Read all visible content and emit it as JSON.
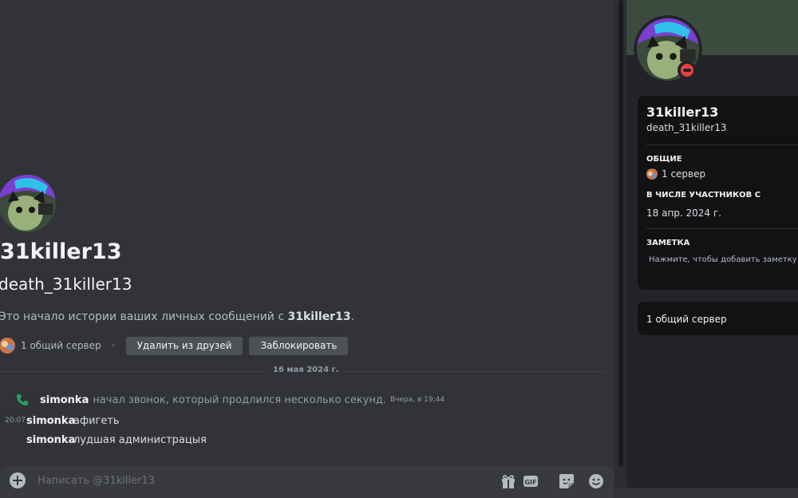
{
  "intro": {
    "display_name": "31killer13",
    "username": "death_31killer13",
    "history_text_prefix": "Это начало истории ваших личных сообщений с ",
    "history_text_name": "31killer13",
    "history_text_suffix": ".",
    "mutual_servers": "1 общий сервер",
    "remove_friend_label": "Удалить из друзей",
    "block_label": "Заблокировать"
  },
  "divider": {
    "date": "16 мая 2024 г."
  },
  "call": {
    "author": "simonka",
    "text": "начал звонок, который продлился несколько секунд.",
    "time": "Вчера, в 19:44",
    "icon": "phone-icon"
  },
  "messages": [
    {
      "time": "20:07",
      "author": "simonka",
      "text": "афигеть"
    },
    {
      "time": "",
      "author": "simonka",
      "text": "лудшая администрацыя"
    }
  ],
  "composer": {
    "placeholder": "Написать @31killer13",
    "icons": [
      "plus-icon",
      "gift-icon",
      "gif-icon",
      "sticker-icon",
      "emoji-icon"
    ],
    "gif_label": "GIF"
  },
  "profile": {
    "display_name": "31killer13",
    "username": "death_31killer13",
    "status": "do-not-disturb",
    "mutual_heading": "ОБЩИЕ",
    "mutual_servers": "1 сервер",
    "member_since_heading": "В ЧИСЛЕ УЧАСТНИКОВ С",
    "member_since": "18 апр. 2024 г.",
    "note_heading": "ЗАМЕТКА",
    "note_placeholder": "Нажмите, чтобы добавить заметку",
    "mutual_server_card": "1 общий сервер"
  },
  "colors": {
    "background": "#313338",
    "sidebar": "#232428",
    "card": "#111214",
    "banner": "#3b4c3e",
    "dnd": "#f23f43",
    "call_green": "#23a55a"
  }
}
